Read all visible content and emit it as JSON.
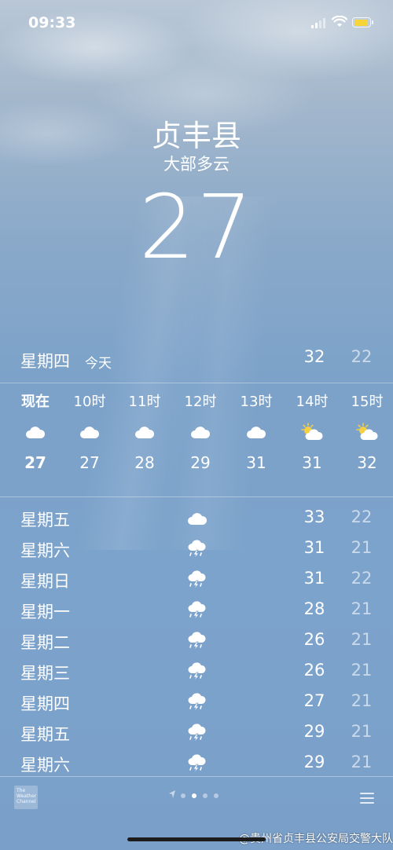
{
  "status_bar": {
    "time": "09:33",
    "battery_color": "#f7d53a"
  },
  "location": {
    "city": "贞丰县",
    "condition": "大部多云",
    "current_temp": "27"
  },
  "today": {
    "day": "星期四",
    "tag": "今天",
    "high": "32",
    "low": "22"
  },
  "hourly": [
    {
      "label": "现在",
      "icon": "cloud-icon",
      "temp": "27"
    },
    {
      "label": "10时",
      "icon": "cloud-icon",
      "temp": "27"
    },
    {
      "label": "11时",
      "icon": "cloud-icon",
      "temp": "28"
    },
    {
      "label": "12时",
      "icon": "cloud-icon",
      "temp": "29"
    },
    {
      "label": "13时",
      "icon": "cloud-icon",
      "temp": "31"
    },
    {
      "label": "14时",
      "icon": "partly-sunny-icon",
      "temp": "31"
    },
    {
      "label": "15时",
      "icon": "partly-sunny-icon",
      "temp": "32"
    }
  ],
  "daily": [
    {
      "day": "星期五",
      "icon": "cloud-icon",
      "high": "33",
      "low": "22"
    },
    {
      "day": "星期六",
      "icon": "thunderstorm-icon",
      "high": "31",
      "low": "21"
    },
    {
      "day": "星期日",
      "icon": "thunderstorm-icon",
      "high": "31",
      "low": "22"
    },
    {
      "day": "星期一",
      "icon": "thunderstorm-icon",
      "high": "28",
      "low": "21"
    },
    {
      "day": "星期二",
      "icon": "thunderstorm-icon",
      "high": "26",
      "low": "21"
    },
    {
      "day": "星期三",
      "icon": "thunderstorm-icon",
      "high": "26",
      "low": "21"
    },
    {
      "day": "星期四",
      "icon": "thunderstorm-icon",
      "high": "27",
      "low": "21"
    },
    {
      "day": "星期五",
      "icon": "thunderstorm-icon",
      "high": "29",
      "low": "21"
    },
    {
      "day": "星期六",
      "icon": "thunderstorm-icon",
      "high": "29",
      "low": "21"
    }
  ],
  "footer": {
    "logo_text": "The Weather Channel",
    "page_dots": 4,
    "active_dot": 1,
    "watermark": "@贵州省贞丰县公安局交警大队"
  }
}
